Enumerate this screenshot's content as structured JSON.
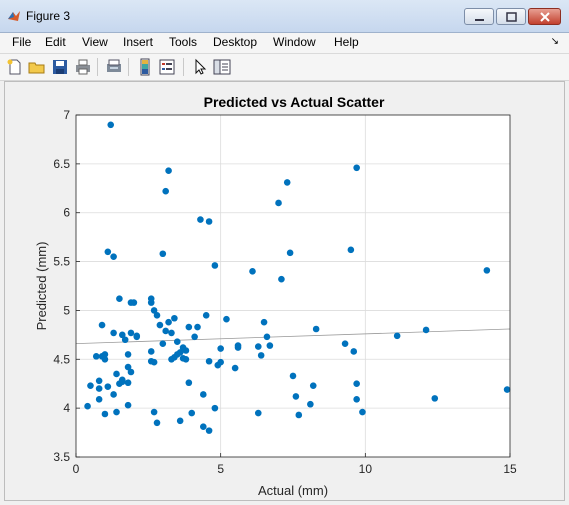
{
  "window": {
    "title": "Figure 3"
  },
  "menubar": {
    "items": [
      "File",
      "Edit",
      "View",
      "Insert",
      "Tools",
      "Desktop",
      "Window",
      "Help"
    ]
  },
  "toolbar": {
    "icons": [
      "new-figure-icon",
      "open-file-icon",
      "save-icon",
      "print-icon",
      "print-preview-icon",
      "insert-colorbar-icon",
      "insert-legend-icon",
      "pointer-icon",
      "property-editor-icon"
    ]
  },
  "chart_data": {
    "type": "scatter",
    "title": "Predicted vs Actual Scatter",
    "xlabel": "Actual (mm)",
    "ylabel": "Predicted (mm)",
    "xlim": [
      0,
      15
    ],
    "ylim": [
      3.5,
      7
    ],
    "xticks": [
      "0",
      "5",
      "10",
      "15"
    ],
    "yticks": [
      "3.5",
      "4",
      "4.5",
      "5",
      "5.5",
      "6",
      "6.5",
      "7"
    ],
    "grid": true,
    "marker_color": "#0072bd",
    "fit_line": {
      "x": [
        0,
        15
      ],
      "y": [
        4.66,
        4.81
      ]
    },
    "points": [
      [
        0.4,
        4.02
      ],
      [
        0.5,
        4.23
      ],
      [
        0.7,
        4.53
      ],
      [
        0.8,
        4.28
      ],
      [
        0.8,
        4.2
      ],
      [
        0.8,
        4.09
      ],
      [
        0.9,
        4.85
      ],
      [
        0.9,
        4.53
      ],
      [
        1.0,
        4.5
      ],
      [
        1.0,
        3.94
      ],
      [
        1.0,
        4.55
      ],
      [
        1.1,
        5.6
      ],
      [
        1.1,
        4.22
      ],
      [
        1.2,
        6.9
      ],
      [
        1.3,
        4.14
      ],
      [
        1.3,
        4.77
      ],
      [
        1.3,
        5.55
      ],
      [
        1.4,
        3.96
      ],
      [
        1.4,
        4.35
      ],
      [
        1.5,
        5.12
      ],
      [
        1.5,
        4.25
      ],
      [
        1.6,
        4.75
      ],
      [
        1.6,
        4.29
      ],
      [
        1.6,
        4.27
      ],
      [
        1.7,
        4.7
      ],
      [
        1.8,
        4.42
      ],
      [
        1.8,
        4.26
      ],
      [
        1.8,
        4.55
      ],
      [
        1.8,
        4.03
      ],
      [
        1.9,
        4.77
      ],
      [
        1.9,
        5.08
      ],
      [
        1.9,
        4.37
      ],
      [
        2.0,
        5.08
      ],
      [
        2.1,
        4.74
      ],
      [
        2.1,
        4.73
      ],
      [
        2.6,
        5.08
      ],
      [
        2.6,
        5.12
      ],
      [
        2.6,
        4.58
      ],
      [
        2.6,
        4.48
      ],
      [
        2.7,
        3.96
      ],
      [
        2.7,
        4.47
      ],
      [
        2.7,
        5.0
      ],
      [
        2.8,
        4.95
      ],
      [
        2.8,
        3.85
      ],
      [
        2.9,
        4.85
      ],
      [
        3.0,
        5.58
      ],
      [
        3.0,
        4.66
      ],
      [
        3.1,
        6.22
      ],
      [
        3.1,
        4.79
      ],
      [
        3.2,
        6.43
      ],
      [
        3.2,
        4.88
      ],
      [
        3.3,
        4.77
      ],
      [
        3.3,
        4.5
      ],
      [
        3.4,
        4.92
      ],
      [
        3.4,
        4.52
      ],
      [
        3.5,
        4.55
      ],
      [
        3.5,
        4.68
      ],
      [
        3.6,
        4.57
      ],
      [
        3.6,
        3.87
      ],
      [
        3.7,
        4.51
      ],
      [
        3.7,
        4.62
      ],
      [
        3.8,
        4.5
      ],
      [
        3.8,
        4.59
      ],
      [
        3.9,
        4.26
      ],
      [
        3.9,
        4.83
      ],
      [
        4.0,
        3.95
      ],
      [
        4.1,
        4.73
      ],
      [
        4.2,
        4.83
      ],
      [
        4.3,
        5.93
      ],
      [
        4.4,
        4.14
      ],
      [
        4.4,
        3.81
      ],
      [
        4.5,
        4.95
      ],
      [
        4.6,
        3.77
      ],
      [
        4.6,
        4.48
      ],
      [
        4.6,
        5.91
      ],
      [
        4.8,
        5.46
      ],
      [
        4.8,
        4.0
      ],
      [
        4.9,
        4.44
      ],
      [
        5.0,
        4.47
      ],
      [
        5.0,
        4.61
      ],
      [
        5.2,
        4.91
      ],
      [
        5.5,
        4.41
      ],
      [
        5.6,
        4.64
      ],
      [
        5.6,
        4.62
      ],
      [
        6.1,
        5.4
      ],
      [
        6.3,
        4.63
      ],
      [
        6.3,
        3.95
      ],
      [
        6.4,
        4.54
      ],
      [
        6.5,
        4.88
      ],
      [
        6.6,
        4.73
      ],
      [
        6.7,
        4.64
      ],
      [
        7.0,
        6.1
      ],
      [
        7.1,
        5.32
      ],
      [
        7.3,
        6.31
      ],
      [
        7.4,
        5.59
      ],
      [
        7.5,
        4.33
      ],
      [
        7.6,
        4.12
      ],
      [
        7.7,
        3.93
      ],
      [
        8.1,
        4.04
      ],
      [
        8.2,
        4.23
      ],
      [
        8.3,
        4.81
      ],
      [
        9.3,
        4.66
      ],
      [
        9.5,
        5.62
      ],
      [
        9.6,
        4.58
      ],
      [
        9.7,
        6.46
      ],
      [
        9.7,
        4.25
      ],
      [
        9.7,
        4.09
      ],
      [
        9.9,
        3.96
      ],
      [
        11.1,
        4.74
      ],
      [
        12.1,
        4.8
      ],
      [
        12.4,
        4.1
      ],
      [
        14.2,
        5.41
      ],
      [
        14.9,
        4.19
      ]
    ]
  }
}
